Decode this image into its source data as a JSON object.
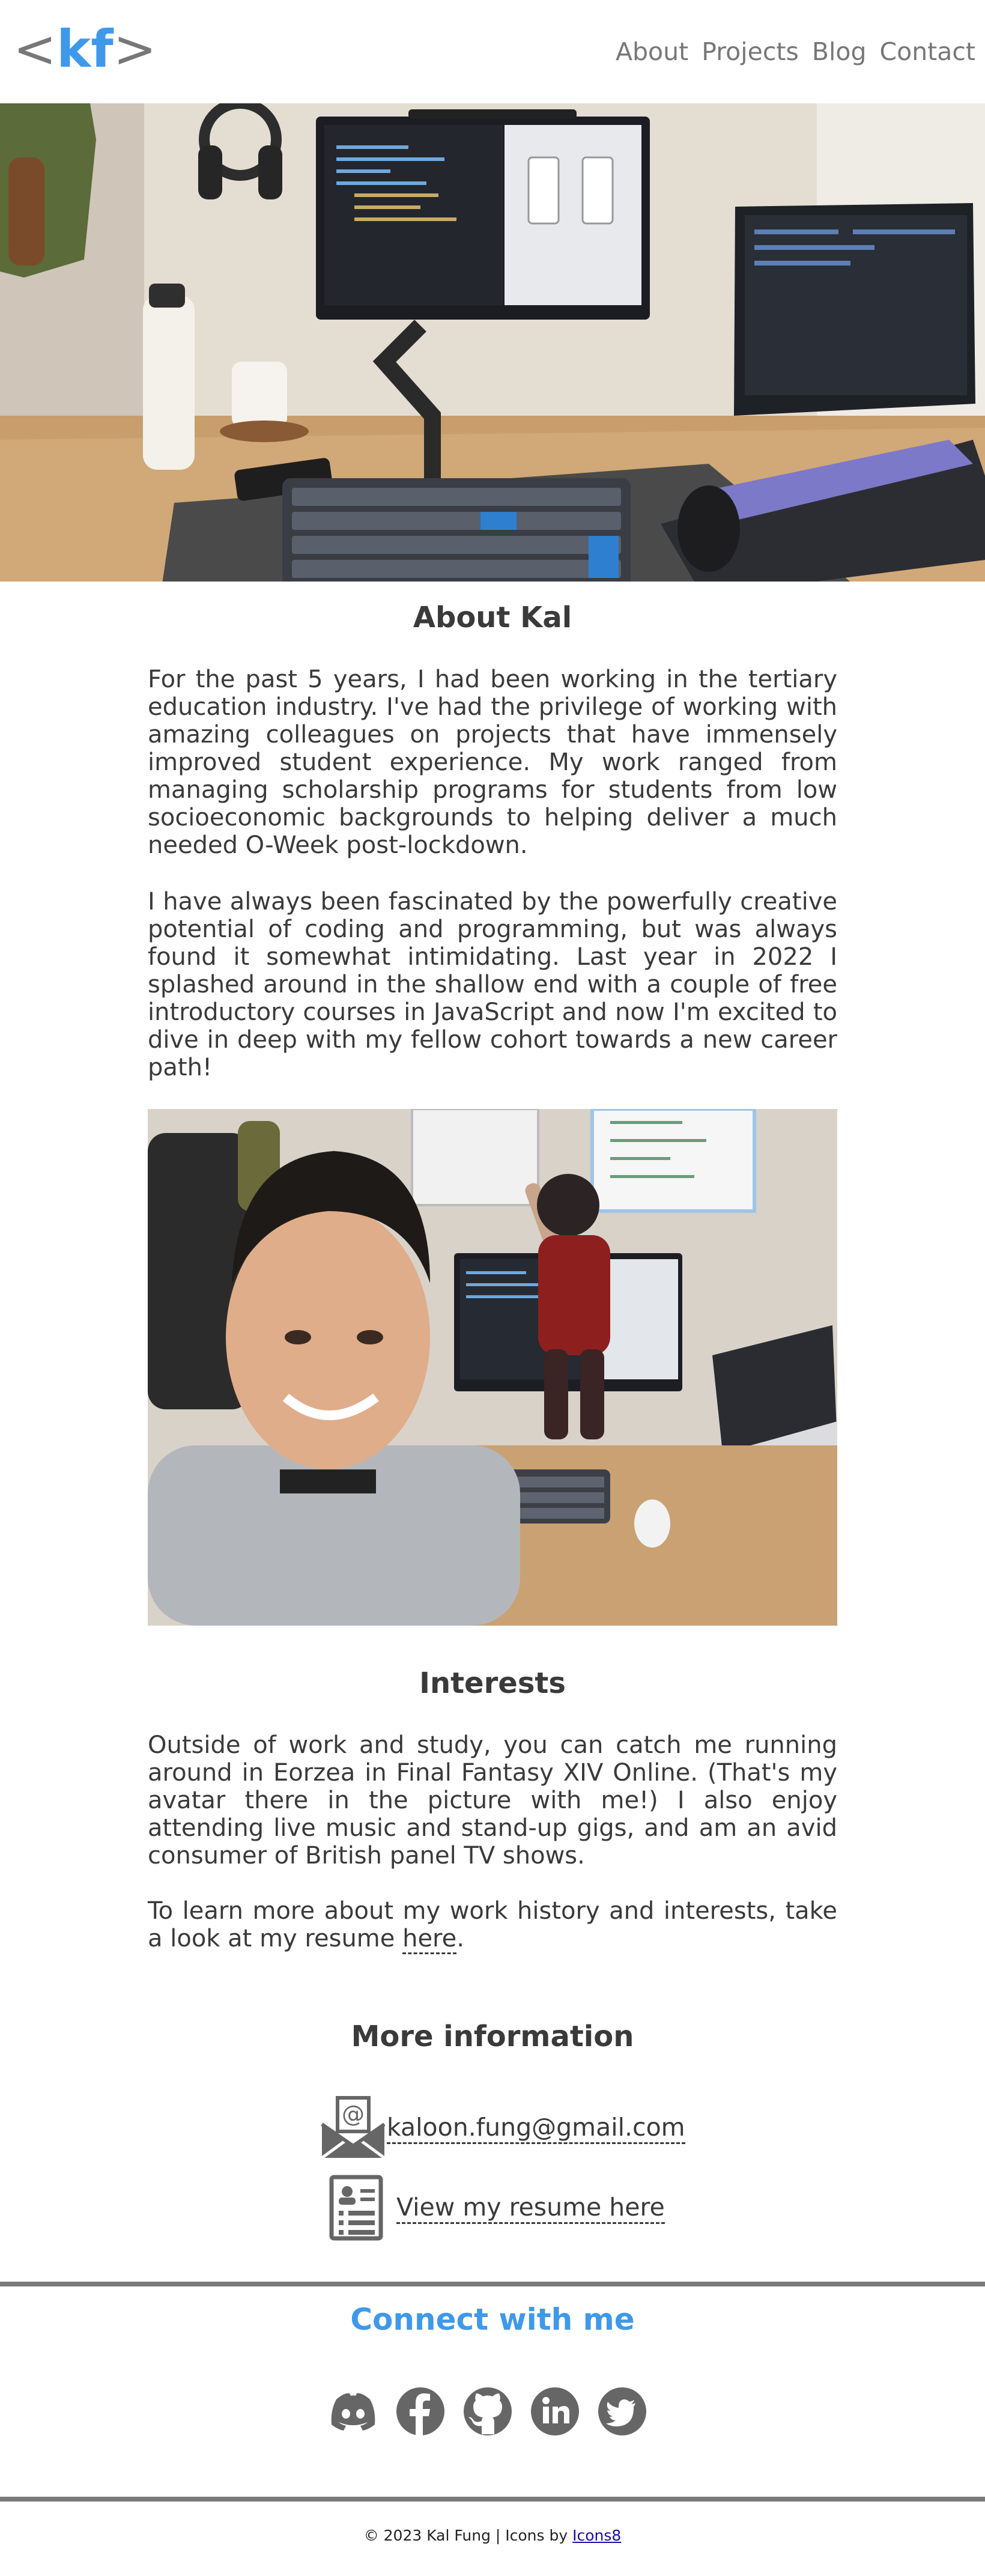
{
  "header": {
    "logo": {
      "open": "<",
      "text": "kf",
      "close": ">"
    },
    "nav": [
      "About",
      "Projects",
      "Blog",
      "Contact"
    ]
  },
  "about": {
    "title": "About Kal",
    "paragraphs": [
      "For the past 5 years, I had been working in the tertiary education industry. I've had the privilege of working with amazing colleagues on projects that have immensely improved student experience. My work ranged from managing scholarship programs for students from low socioeconomic backgrounds to helping deliver a much needed O-Week post-lockdown.",
      "I have always been fascinated by the powerfully creative potential of coding and programming, but was always found it somewhat intimidating. Last year in 2022 I splashed around in the shallow end with a couple of free introductory courses in JavaScript and now I'm excited to dive in deep with my fellow cohort towards a new career path!"
    ]
  },
  "interests": {
    "title": "Interests",
    "paragraph": "Outside of work and study, you can catch me running around in Eorzea in Final Fantasy XIV Online. (That's my avatar there in the picture with me!) I also enjoy attending live music and stand-up gigs, and am an avid consumer of British panel TV shows.",
    "resume_prefix": "To learn more about my work history and interests, take a look at my resume ",
    "resume_link": "here",
    "resume_suffix": "."
  },
  "more_info": {
    "title": "More information",
    "email": "kaloon.fung@gmail.com",
    "resume_link": "View my resume here"
  },
  "connect": {
    "title": "Connect with me",
    "icons": [
      "discord-icon",
      "facebook-icon",
      "github-icon",
      "linkedin-icon",
      "twitter-icon"
    ]
  },
  "footer": {
    "text": "© 2023 Kal Fung | Icons by ",
    "link": "Icons8"
  },
  "colors": {
    "accent": "#3f99ea",
    "text": "#3a3a3a",
    "muted": "#777777",
    "divider": "#7a7a7a"
  }
}
